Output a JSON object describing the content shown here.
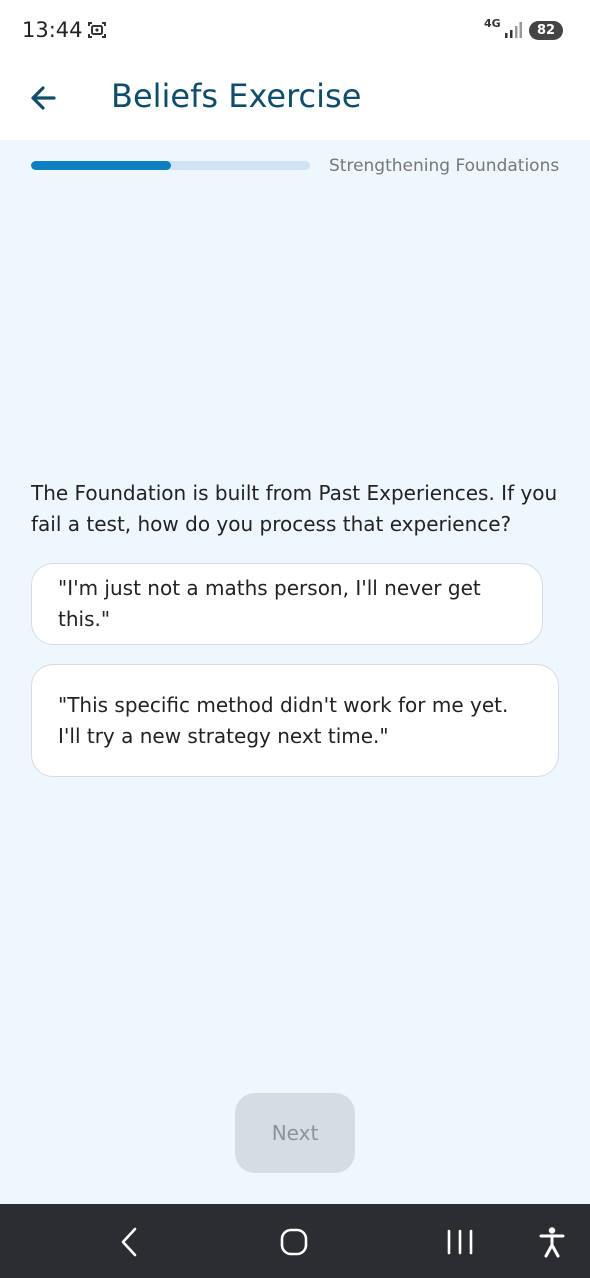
{
  "status_bar": {
    "time": "13:44",
    "network": "4G",
    "battery": "82",
    "icons": [
      "screenshot-icon",
      "signal-icon",
      "battery-icon"
    ]
  },
  "app_bar": {
    "title": "Beliefs Exercise",
    "back_icon": "arrow-left-icon"
  },
  "progress": {
    "label": "Strengthening Foundations",
    "fraction": 0.5,
    "fill_color": "#0e7fc0",
    "track_color": "#cfe3f5"
  },
  "question": {
    "text": "The Foundation is built from Past Experiences. If you fail a test, how do you process that experience?",
    "options": [
      {
        "text": "\"I'm just not a maths person, I'll never get this.\""
      },
      {
        "text": "\"This specific method didn't work for me yet. I'll try a new strategy next time.\""
      }
    ]
  },
  "next_button": {
    "label": "Next",
    "enabled": false
  },
  "nav_bar": {
    "icons": [
      "back-chevron-icon",
      "home-icon",
      "recents-icon",
      "accessibility-icon"
    ]
  },
  "colors": {
    "background": "#eef6fe",
    "title": "#0f4d6a",
    "nav_bar": "#2c2d31"
  }
}
